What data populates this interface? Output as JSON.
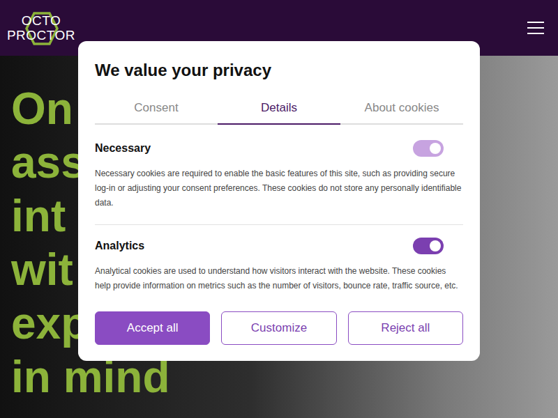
{
  "header": {
    "logo": {
      "line1": "OCTO",
      "line2": "PROCTOR"
    }
  },
  "hero": {
    "lines": [
      "On",
      "ass",
      "int",
      "wit",
      "exp",
      "in mind"
    ]
  },
  "dialog": {
    "title": "We value your privacy",
    "tabs": [
      {
        "label": "Consent",
        "selected": false
      },
      {
        "label": "Details",
        "selected": true
      },
      {
        "label": "About cookies",
        "selected": false
      }
    ],
    "categories": [
      {
        "name": "Necessary",
        "on": true,
        "disabled": true,
        "description": "Necessary cookies are required to enable the basic features of this site, such as providing secure log-in or adjusting your consent preferences. These cookies do not store any personally identifiable data."
      },
      {
        "name": "Analytics",
        "on": true,
        "disabled": false,
        "description": "Analytical cookies are used to understand how visitors interact with the website. These cookies help provide information on metrics such as the number of visitors, bounce rate, traffic source, etc."
      }
    ],
    "buttons": [
      {
        "label": "Accept all",
        "kind": "primary"
      },
      {
        "label": "Customize",
        "kind": "outline"
      },
      {
        "label": "Reject all",
        "kind": "outline"
      }
    ]
  }
}
